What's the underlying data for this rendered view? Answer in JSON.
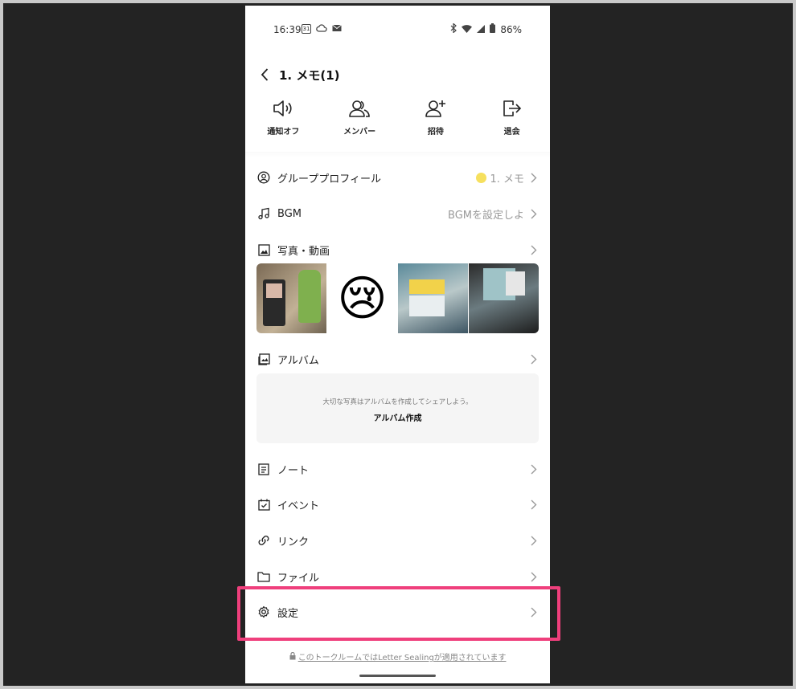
{
  "status_bar": {
    "time": "16:39",
    "calendar_day": "31",
    "battery": "86%"
  },
  "header": {
    "title": "1. メモ(1)"
  },
  "actions": [
    {
      "label": "通知オフ",
      "icon": "speaker-icon"
    },
    {
      "label": "メンバー",
      "icon": "members-icon"
    },
    {
      "label": "招待",
      "icon": "add-person-icon"
    },
    {
      "label": "退会",
      "icon": "exit-icon"
    }
  ],
  "rows": {
    "group_profile": {
      "label": "グループプロフィール",
      "value": "1. メモ"
    },
    "bgm": {
      "label": "BGM",
      "value": "BGMを設定しよ"
    },
    "photos": {
      "label": "写真・動画"
    },
    "album": {
      "label": "アルバム"
    },
    "note": {
      "label": "ノート"
    },
    "event": {
      "label": "イベント"
    },
    "link": {
      "label": "リンク"
    },
    "file": {
      "label": "ファイル"
    },
    "settings": {
      "label": "設定"
    }
  },
  "thumbnails": [
    {
      "icon": "photo-thumbnail"
    },
    {
      "icon": "crying-face-emoji",
      "emoji": "😢"
    },
    {
      "icon": "photo-thumbnail"
    },
    {
      "icon": "photo-thumbnail"
    }
  ],
  "album_box": {
    "hint": "大切な写真はアルバムを作成してシェアしよう。",
    "create_label": "アルバム作成"
  },
  "footer": {
    "text": "このトークルームではLetter Sealingが適用されています"
  },
  "colors": {
    "highlight": "#ef3f7c",
    "profile_dot": "#f6e05e"
  }
}
